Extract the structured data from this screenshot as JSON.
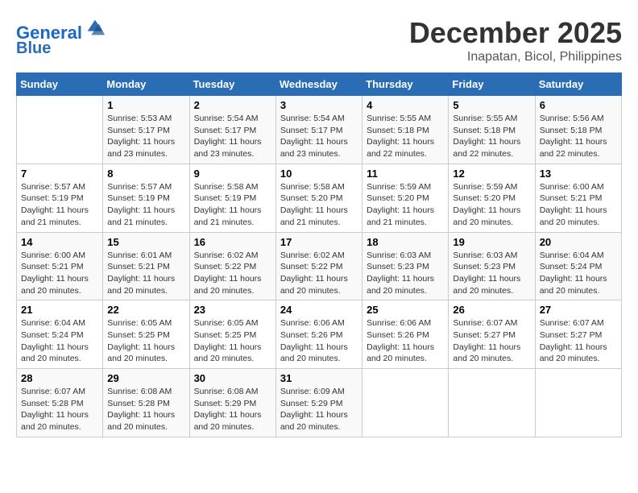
{
  "logo": {
    "line1": "General",
    "line2": "Blue"
  },
  "title": "December 2025",
  "subtitle": "Inapatan, Bicol, Philippines",
  "days_of_week": [
    "Sunday",
    "Monday",
    "Tuesday",
    "Wednesday",
    "Thursday",
    "Friday",
    "Saturday"
  ],
  "weeks": [
    [
      {
        "num": "",
        "info": ""
      },
      {
        "num": "1",
        "info": "Sunrise: 5:53 AM\nSunset: 5:17 PM\nDaylight: 11 hours\nand 23 minutes."
      },
      {
        "num": "2",
        "info": "Sunrise: 5:54 AM\nSunset: 5:17 PM\nDaylight: 11 hours\nand 23 minutes."
      },
      {
        "num": "3",
        "info": "Sunrise: 5:54 AM\nSunset: 5:17 PM\nDaylight: 11 hours\nand 23 minutes."
      },
      {
        "num": "4",
        "info": "Sunrise: 5:55 AM\nSunset: 5:18 PM\nDaylight: 11 hours\nand 22 minutes."
      },
      {
        "num": "5",
        "info": "Sunrise: 5:55 AM\nSunset: 5:18 PM\nDaylight: 11 hours\nand 22 minutes."
      },
      {
        "num": "6",
        "info": "Sunrise: 5:56 AM\nSunset: 5:18 PM\nDaylight: 11 hours\nand 22 minutes."
      }
    ],
    [
      {
        "num": "7",
        "info": "Sunrise: 5:57 AM\nSunset: 5:19 PM\nDaylight: 11 hours\nand 21 minutes."
      },
      {
        "num": "8",
        "info": "Sunrise: 5:57 AM\nSunset: 5:19 PM\nDaylight: 11 hours\nand 21 minutes."
      },
      {
        "num": "9",
        "info": "Sunrise: 5:58 AM\nSunset: 5:19 PM\nDaylight: 11 hours\nand 21 minutes."
      },
      {
        "num": "10",
        "info": "Sunrise: 5:58 AM\nSunset: 5:20 PM\nDaylight: 11 hours\nand 21 minutes."
      },
      {
        "num": "11",
        "info": "Sunrise: 5:59 AM\nSunset: 5:20 PM\nDaylight: 11 hours\nand 21 minutes."
      },
      {
        "num": "12",
        "info": "Sunrise: 5:59 AM\nSunset: 5:20 PM\nDaylight: 11 hours\nand 20 minutes."
      },
      {
        "num": "13",
        "info": "Sunrise: 6:00 AM\nSunset: 5:21 PM\nDaylight: 11 hours\nand 20 minutes."
      }
    ],
    [
      {
        "num": "14",
        "info": "Sunrise: 6:00 AM\nSunset: 5:21 PM\nDaylight: 11 hours\nand 20 minutes."
      },
      {
        "num": "15",
        "info": "Sunrise: 6:01 AM\nSunset: 5:21 PM\nDaylight: 11 hours\nand 20 minutes."
      },
      {
        "num": "16",
        "info": "Sunrise: 6:02 AM\nSunset: 5:22 PM\nDaylight: 11 hours\nand 20 minutes."
      },
      {
        "num": "17",
        "info": "Sunrise: 6:02 AM\nSunset: 5:22 PM\nDaylight: 11 hours\nand 20 minutes."
      },
      {
        "num": "18",
        "info": "Sunrise: 6:03 AM\nSunset: 5:23 PM\nDaylight: 11 hours\nand 20 minutes."
      },
      {
        "num": "19",
        "info": "Sunrise: 6:03 AM\nSunset: 5:23 PM\nDaylight: 11 hours\nand 20 minutes."
      },
      {
        "num": "20",
        "info": "Sunrise: 6:04 AM\nSunset: 5:24 PM\nDaylight: 11 hours\nand 20 minutes."
      }
    ],
    [
      {
        "num": "21",
        "info": "Sunrise: 6:04 AM\nSunset: 5:24 PM\nDaylight: 11 hours\nand 20 minutes."
      },
      {
        "num": "22",
        "info": "Sunrise: 6:05 AM\nSunset: 5:25 PM\nDaylight: 11 hours\nand 20 minutes."
      },
      {
        "num": "23",
        "info": "Sunrise: 6:05 AM\nSunset: 5:25 PM\nDaylight: 11 hours\nand 20 minutes."
      },
      {
        "num": "24",
        "info": "Sunrise: 6:06 AM\nSunset: 5:26 PM\nDaylight: 11 hours\nand 20 minutes."
      },
      {
        "num": "25",
        "info": "Sunrise: 6:06 AM\nSunset: 5:26 PM\nDaylight: 11 hours\nand 20 minutes."
      },
      {
        "num": "26",
        "info": "Sunrise: 6:07 AM\nSunset: 5:27 PM\nDaylight: 11 hours\nand 20 minutes."
      },
      {
        "num": "27",
        "info": "Sunrise: 6:07 AM\nSunset: 5:27 PM\nDaylight: 11 hours\nand 20 minutes."
      }
    ],
    [
      {
        "num": "28",
        "info": "Sunrise: 6:07 AM\nSunset: 5:28 PM\nDaylight: 11 hours\nand 20 minutes."
      },
      {
        "num": "29",
        "info": "Sunrise: 6:08 AM\nSunset: 5:28 PM\nDaylight: 11 hours\nand 20 minutes."
      },
      {
        "num": "30",
        "info": "Sunrise: 6:08 AM\nSunset: 5:29 PM\nDaylight: 11 hours\nand 20 minutes."
      },
      {
        "num": "31",
        "info": "Sunrise: 6:09 AM\nSunset: 5:29 PM\nDaylight: 11 hours\nand 20 minutes."
      },
      {
        "num": "",
        "info": ""
      },
      {
        "num": "",
        "info": ""
      },
      {
        "num": "",
        "info": ""
      }
    ]
  ]
}
